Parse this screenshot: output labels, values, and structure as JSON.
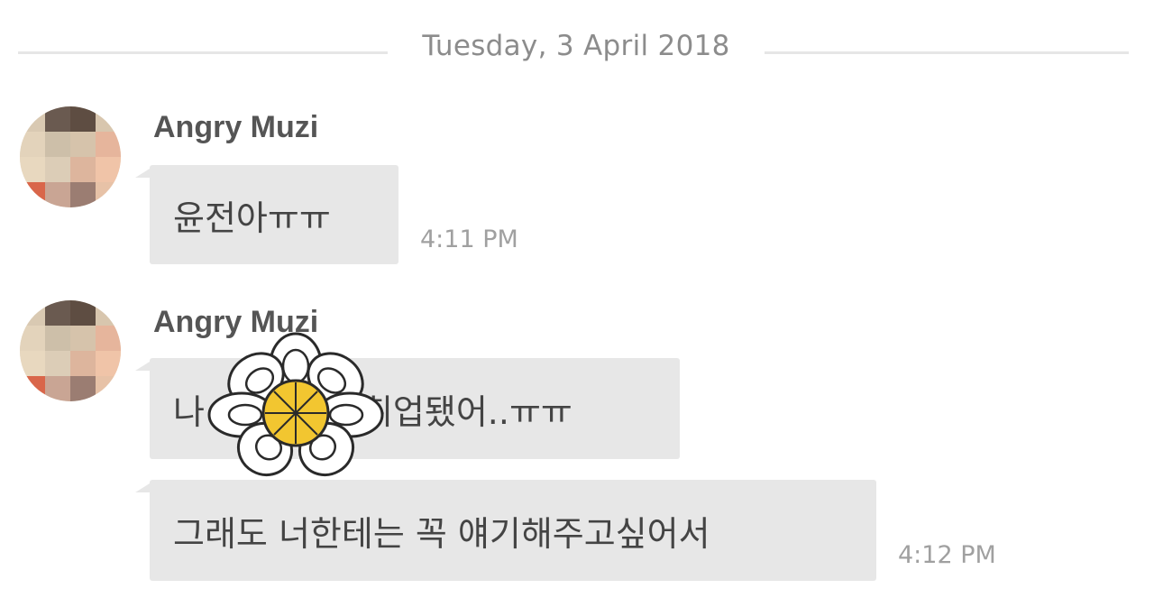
{
  "date_divider": "Tuesday, 3 April 2018",
  "messages": [
    {
      "sender": "Angry Muzi",
      "bubbles": [
        {
          "text": "윤전아ㅠㅠ",
          "time": "4:11 PM"
        }
      ]
    },
    {
      "sender": "Angry Muzi",
      "bubbles": [
        {
          "text": "나",
          "text_after": "취업됐어..ㅠㅠ",
          "time": ""
        },
        {
          "text": "그래도 너한테는 꼭 얘기해주고싶어서",
          "time": "4:12 PM"
        }
      ]
    }
  ],
  "icons": {
    "avatar": "pixelated-avatar",
    "sticker": "flower-sticker-icon"
  },
  "colors": {
    "bubble": "#e7e7e7",
    "divider_line": "#e6e6e6",
    "flower_center": "#f2c630"
  }
}
